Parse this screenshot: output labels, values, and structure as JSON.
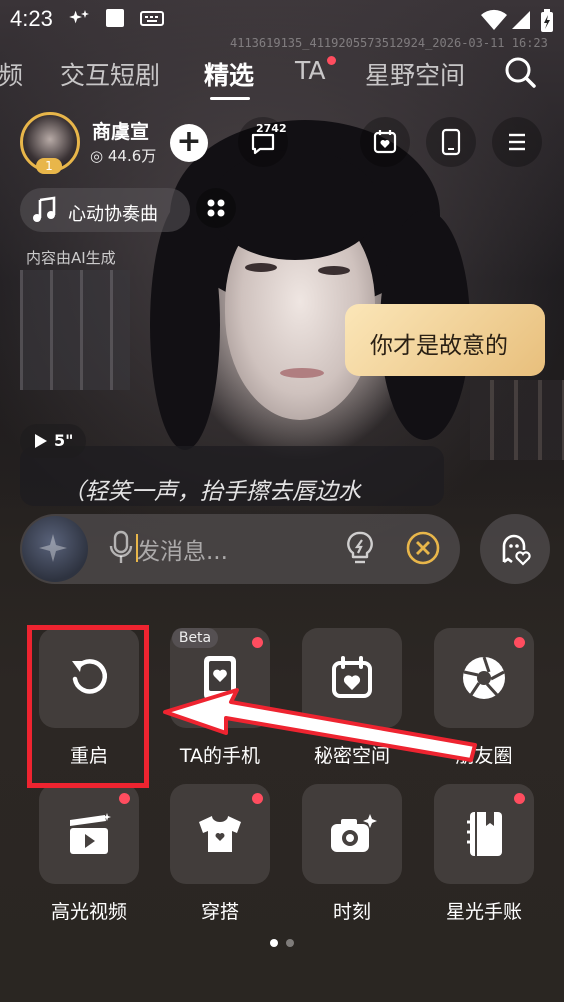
{
  "status_bar": {
    "time": "4:23"
  },
  "watermark": "4113619135_4119205573512924_2026-03-11 16:23",
  "tabs": [
    {
      "label": "频"
    },
    {
      "label": "交互短剧"
    },
    {
      "label": "精选",
      "active": true
    },
    {
      "label": "TA"
    },
    {
      "label": "星野空间"
    }
  ],
  "character": {
    "name": "商虞宣",
    "fans": "44.6万",
    "level": "1"
  },
  "toolbar": {
    "message_count": "2742"
  },
  "music": {
    "title": "心动协奏曲"
  },
  "ai_note": "内容由AI生成",
  "chat": {
    "bubble_text": "你才是故意的",
    "voice_duration": "5\"",
    "narration": "（轻笑一声，抬手擦去唇边水"
  },
  "input": {
    "placeholder": "发消息..."
  },
  "features": [
    {
      "label": "重启",
      "icon": "restart-icon",
      "badge": false
    },
    {
      "label": "TA的手机",
      "icon": "phone-heart-icon",
      "badge": true,
      "tag": "Beta"
    },
    {
      "label": "秘密空间",
      "icon": "calendar-heart-icon",
      "badge": false
    },
    {
      "label": "朋友圈",
      "icon": "aperture-icon",
      "badge": true
    },
    {
      "label": "高光视频",
      "icon": "clapper-icon",
      "badge": true
    },
    {
      "label": "穿搭",
      "icon": "tshirt-icon",
      "badge": true
    },
    {
      "label": "时刻",
      "icon": "camera-sparkle-icon",
      "badge": false
    },
    {
      "label": "星光手账",
      "icon": "notebook-icon",
      "badge": true
    }
  ],
  "annotation_color": "#ee2430",
  "accent_color": "#e8b64a"
}
